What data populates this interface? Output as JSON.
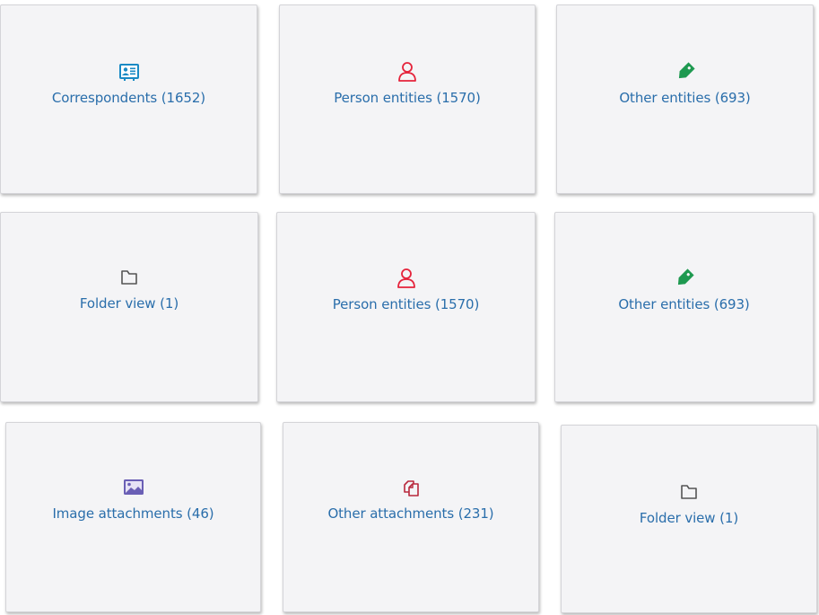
{
  "cards": [
    {
      "label": "Correspondents (1652)",
      "icon": "contact-card-icon",
      "color": "#1a8ac4"
    },
    {
      "label": "Person entities (1570)",
      "icon": "person-icon",
      "color": "#e5233b"
    },
    {
      "label": "Other entities (693)",
      "icon": "tag-icon",
      "color": "#1e9950"
    },
    {
      "label": "Folder view (1)",
      "icon": "folder-icon",
      "color": "#555555"
    },
    {
      "label": "Person entities (1570)",
      "icon": "person-icon",
      "color": "#e5233b"
    },
    {
      "label": "Other entities (693)",
      "icon": "tag-icon",
      "color": "#1e9950"
    },
    {
      "label": "Image attachments (46)",
      "icon": "image-icon",
      "color": "#6a5fb5"
    },
    {
      "label": "Other attachments (231)",
      "icon": "attachments-icon",
      "color": "#b8283c"
    },
    {
      "label": "Folder view (1)",
      "icon": "folder-icon",
      "color": "#555555"
    }
  ]
}
